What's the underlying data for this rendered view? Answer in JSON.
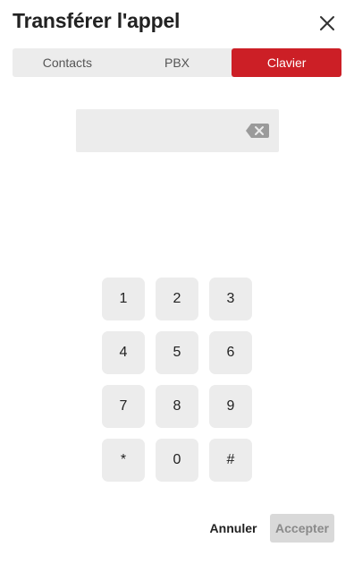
{
  "dialog": {
    "title": "Transférer l'appel",
    "close_icon": "close-icon"
  },
  "tabs": [
    {
      "label": "Contacts",
      "active": false
    },
    {
      "label": "PBX",
      "active": false
    },
    {
      "label": "Clavier",
      "active": true
    }
  ],
  "number_field": {
    "value": "",
    "placeholder": "",
    "backspace_icon": "backspace-icon"
  },
  "keypad": {
    "keys": [
      "1",
      "2",
      "3",
      "4",
      "5",
      "6",
      "7",
      "8",
      "9",
      "*",
      "0",
      "#"
    ]
  },
  "footer": {
    "cancel_label": "Annuler",
    "accept_label": "Accepter"
  },
  "colors": {
    "accent": "#cc1f26",
    "key_bg": "#ececec",
    "disabled_bg": "#d9d9d9",
    "disabled_text": "#8a8a8a"
  }
}
